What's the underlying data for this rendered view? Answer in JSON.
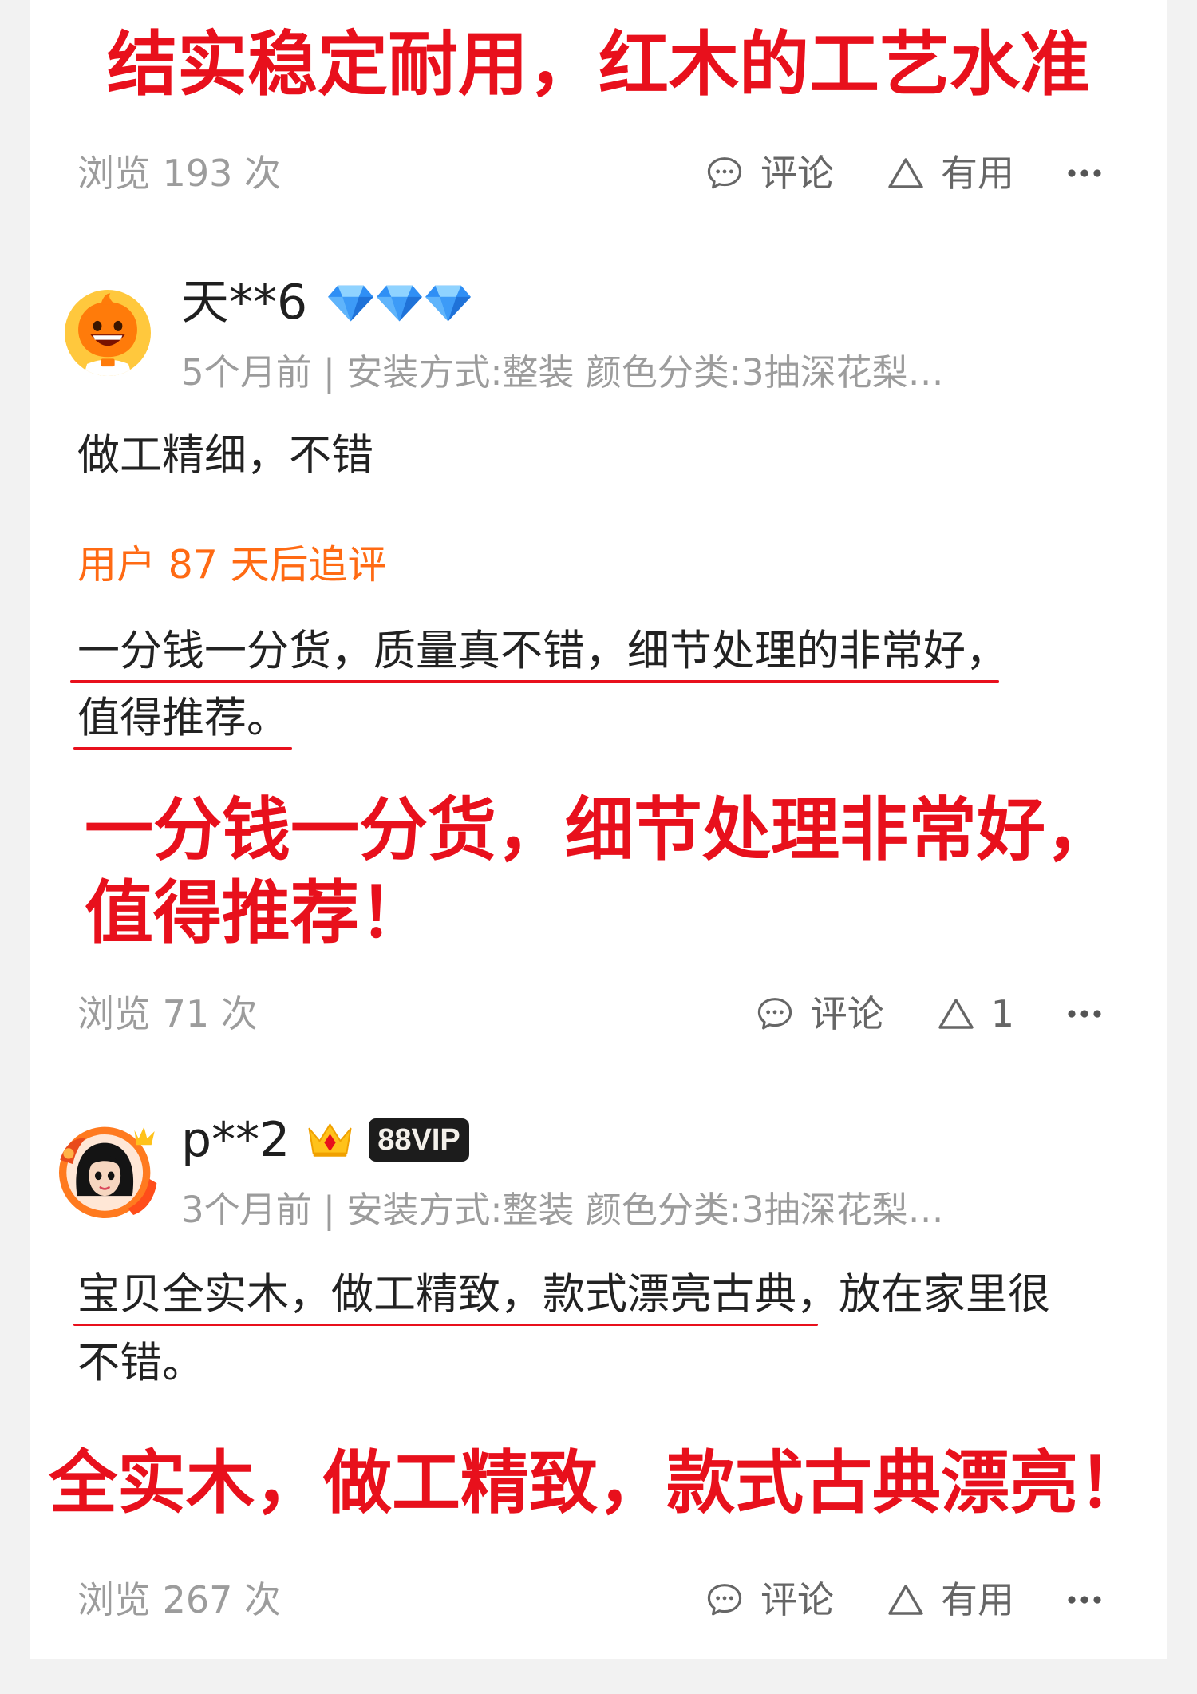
{
  "headline": "结实稳定耐用，红木的工艺水准",
  "colors": {
    "annotation_red": "#e8101c",
    "followup_orange": "#ff6a13",
    "muted_gray": "#9c9c9c",
    "body_text": "#222222",
    "action_gray": "#666666",
    "page_background": "#f2f2f2",
    "card_background": "#ffffff"
  },
  "icons": {
    "comment": "comment-icon",
    "useful": "triangle-up-icon",
    "more": "more-icon"
  },
  "top_stats": {
    "views": "浏览 193 次",
    "comment_label": "评论",
    "useful_label": "有用"
  },
  "reviews": [
    {
      "avatar_icon": "orange-mascot-avatar",
      "username": "天**6",
      "level_badge": {
        "icon": "diamond-icon",
        "count": 3
      },
      "meta": "5个月前 | 安装方式:整装 颜色分类:3抽深花梨…",
      "body_lines": [
        "做工精细，不错"
      ],
      "followup_label": "用户 87 天后追评",
      "followup_lines": [
        "一分钱一分货，质量真不错，细节处理的非常好，",
        "值得推荐。"
      ],
      "annotation_lines": [
        "一分钱一分货，细节处理非常好，",
        "值得推荐！"
      ],
      "stats": {
        "views": "浏览 71 次",
        "comment_label": "评论",
        "useful_label": "1"
      }
    },
    {
      "avatar_icon": "cartoon-girl-avatar",
      "username": "p**2",
      "crown_icon": "crown-icon",
      "vip_badge": "88VIP",
      "meta": "3个月前 | 安装方式:整装 颜色分类:3抽深花梨…",
      "body_lines": [
        "宝贝全实木，做工精致，款式漂亮古典，放在家里很",
        "不错。"
      ],
      "annotation_lines": [
        "全实木，做工精致，款式古典漂亮！"
      ],
      "stats": {
        "views": "浏览 267 次",
        "comment_label": "评论",
        "useful_label": "有用"
      }
    }
  ]
}
